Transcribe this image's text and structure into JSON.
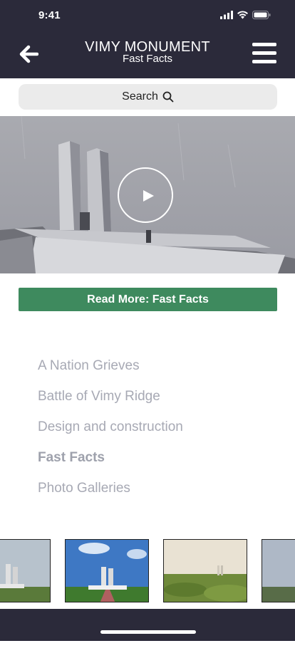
{
  "status_bar": {
    "time": "9:41"
  },
  "nav": {
    "title": "VIMY MONUMENT",
    "subtitle": "Fast Facts"
  },
  "search": {
    "label": "Search"
  },
  "hero": {
    "media": "video"
  },
  "read_more": {
    "label": "Read More: Fast Facts"
  },
  "links": [
    {
      "label": "A Nation Grieves",
      "active": false
    },
    {
      "label": "Battle of Vimy Ridge",
      "active": false
    },
    {
      "label": "Design and construction",
      "active": false
    },
    {
      "label": "Fast Facts",
      "active": true
    },
    {
      "label": "Photo Galleries",
      "active": false
    }
  ],
  "colors": {
    "header_bg": "#2b2a3a",
    "accent_green": "#3e8a5e",
    "link_text": "#a7a9b4",
    "search_bg": "#ebebeb"
  }
}
